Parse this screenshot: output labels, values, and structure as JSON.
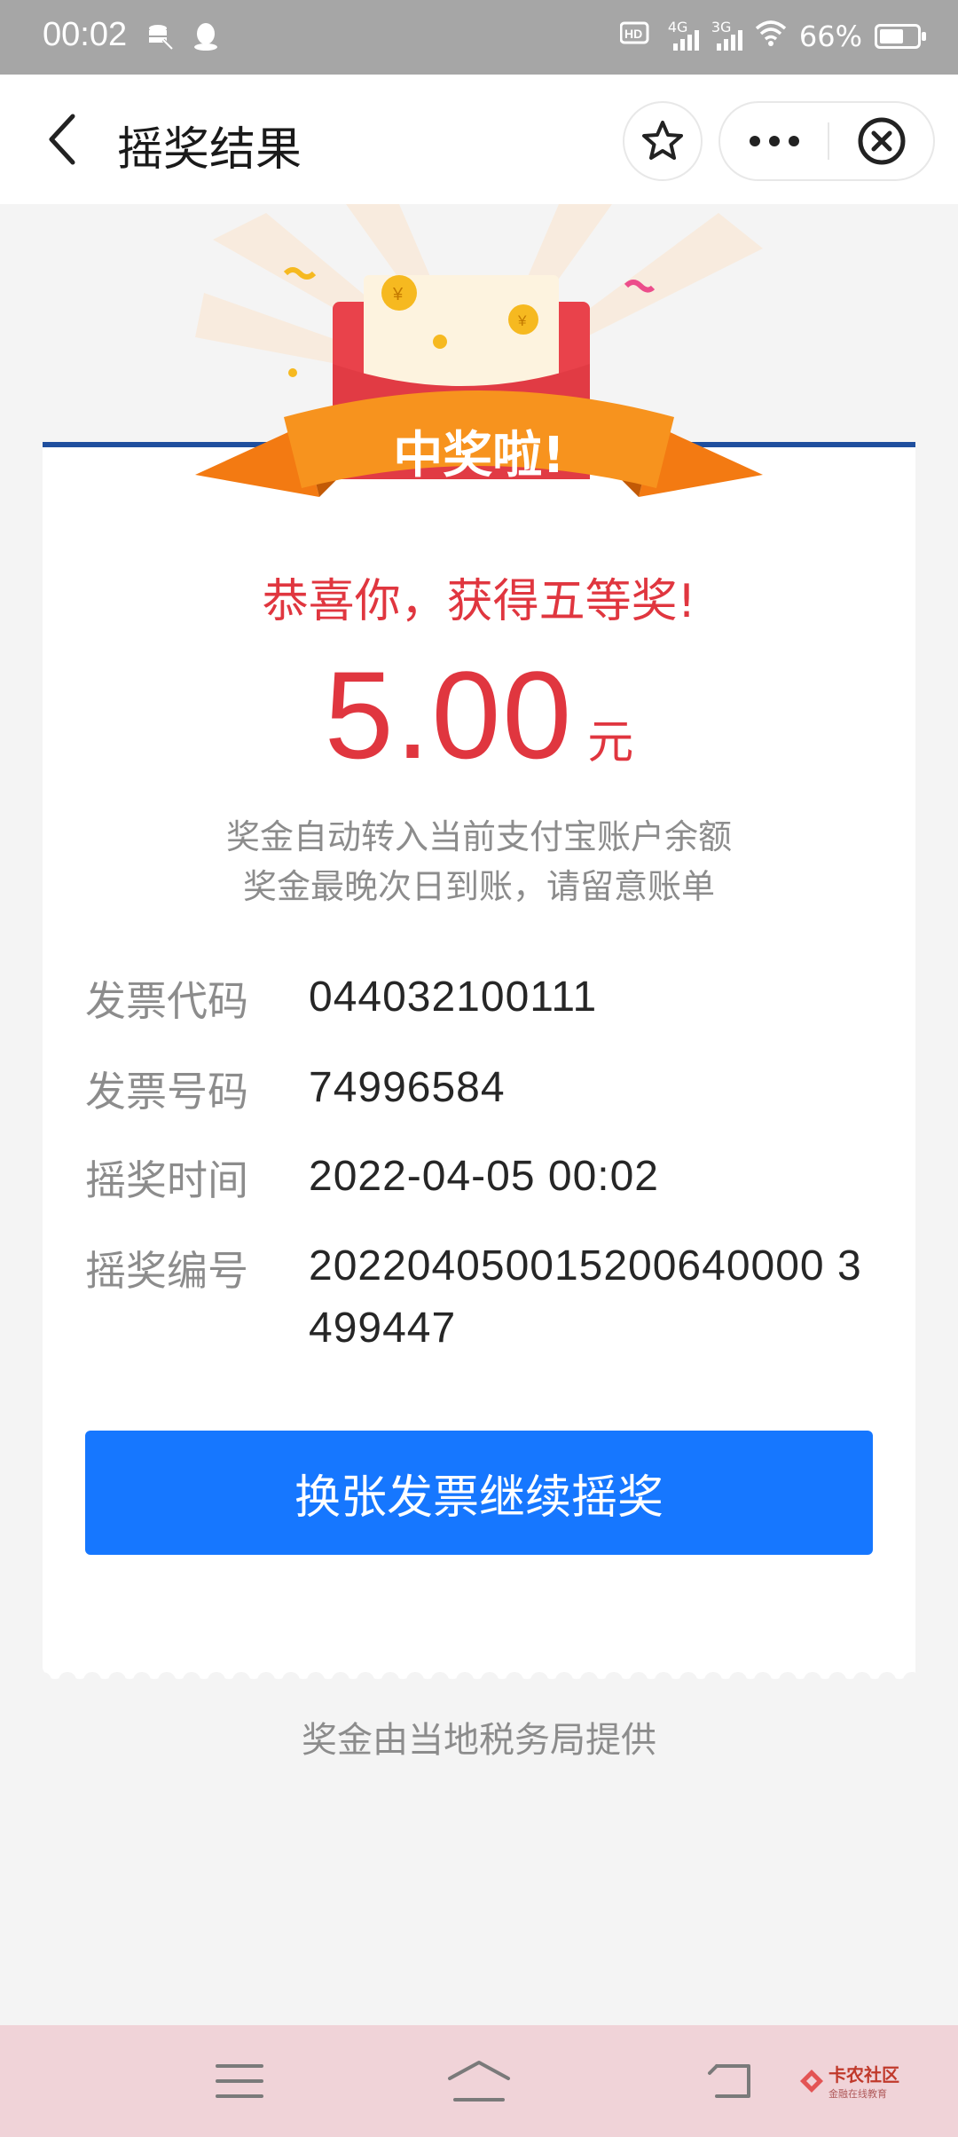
{
  "status_bar": {
    "time": "00:02",
    "network_1": "4G",
    "network_2": "3G",
    "battery_text": "66%",
    "battery_level": 0.66
  },
  "nav": {
    "title": "摇奖结果"
  },
  "banner": {
    "ribbon_text": "中奖啦!"
  },
  "result": {
    "congrats": "恭喜你，获得五等奖!",
    "amount": "5.00",
    "unit": "元",
    "notice_line1": "奖金自动转入当前支付宝账户余额",
    "notice_line2": "奖金最晚次日到账，请留意账单"
  },
  "details": [
    {
      "label": "发票代码",
      "value": "044032100111"
    },
    {
      "label": "发票号码",
      "value": "74996584"
    },
    {
      "label": "摇奖时间",
      "value": "2022-04-05 00:02"
    },
    {
      "label": "摇奖编号",
      "value": "202204050015200640000 3499447"
    }
  ],
  "action_button_label": "换张发票继续摇奖",
  "footer_note": "奖金由当地税务局提供",
  "watermark": {
    "title": "卡农社区",
    "subtitle": "金融在线教育"
  },
  "colors": {
    "prize_red": "#e0363f",
    "primary_blue": "#1677ff",
    "ribbon_orange": "#f7931e"
  }
}
